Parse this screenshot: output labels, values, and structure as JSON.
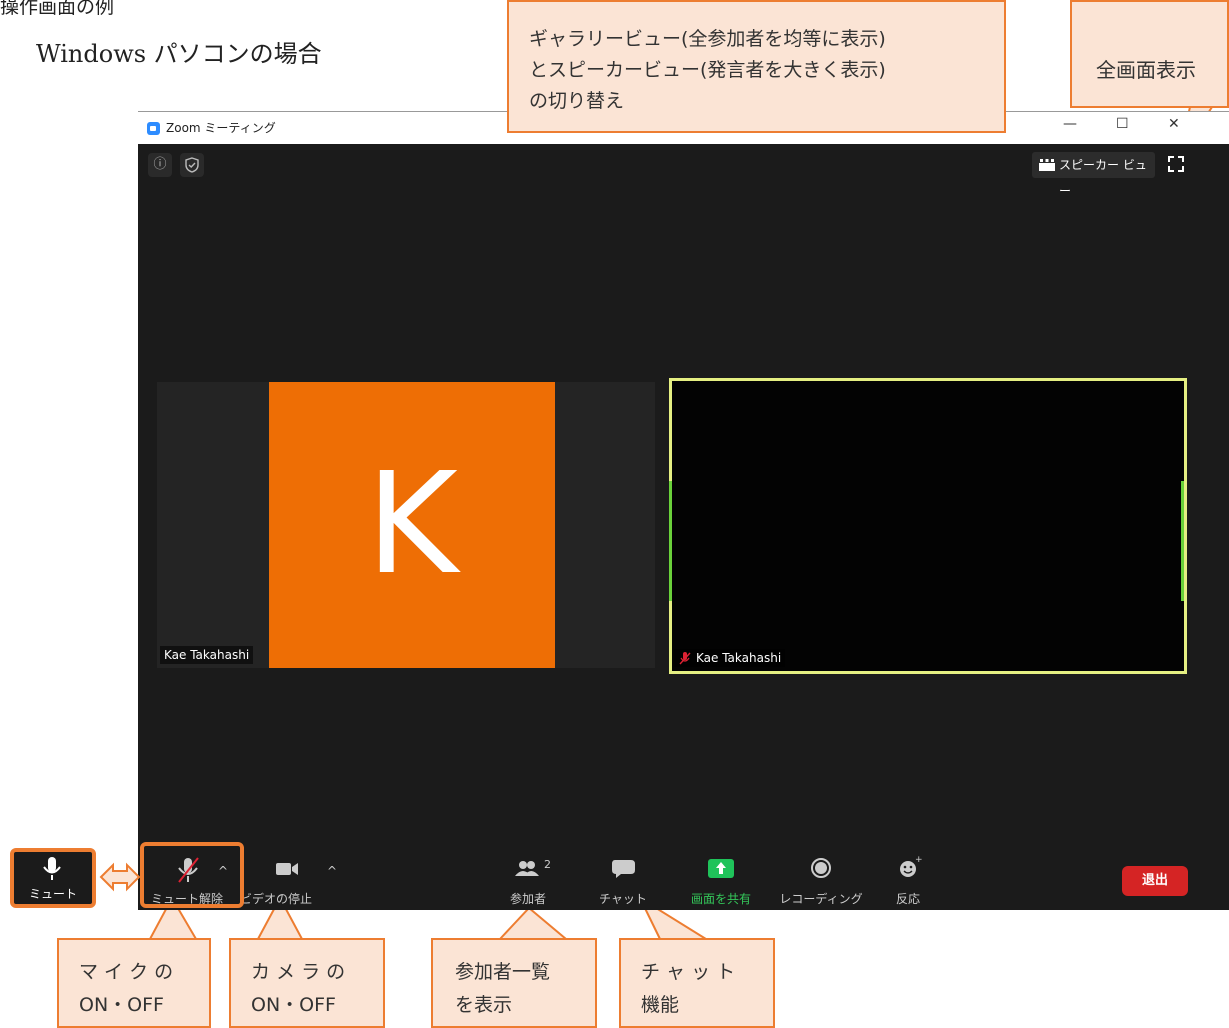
{
  "doc": {
    "heading": "操作画面の例",
    "subheading": "Windows パソコンの場合"
  },
  "window": {
    "title": "Zoom ミーティング",
    "minimize_glyph": "—",
    "maximize_glyph": "☐",
    "close_glyph": "✕",
    "info_glyph": "ⓘ",
    "security_glyph": "✓",
    "speaker_view_label": "スピーカー ビュー"
  },
  "participants": [
    {
      "name": "Kae Takahashi",
      "avatar_letter": "K"
    },
    {
      "name": "Kae Takahashi"
    }
  ],
  "toolbar": {
    "unmute_label": "ミュート解除",
    "video_label": "ビデオの停止",
    "participants_label": "参加者",
    "participants_count": "2",
    "chat_label": "チャット",
    "share_label": "画面を共有",
    "record_label": "レコーディング",
    "reactions_label": "反応",
    "leave_label": "退出",
    "caret_glyph": "^"
  },
  "mute_button": {
    "label": "ミュート"
  },
  "callouts": {
    "gallery": [
      "ギャラリービュー(全参加者を均等に表示)",
      "とスピーカービュー(発言者を大きく表示)",
      "の切り替え"
    ],
    "fullscreen": [
      "全画面表示"
    ],
    "mic": [
      "マ イ ク の",
      "ON・OFF"
    ],
    "camera": [
      "カ メ ラ の",
      "ON・OFF"
    ],
    "participants": [
      "参加者一覧",
      "を表示"
    ],
    "chat": [
      "チ ャ ッ ト",
      "機能"
    ]
  },
  "colors": {
    "callout_fill": "#fbe4d5",
    "callout_border": "#ed7d31",
    "avatar_bg": "#ee6e05",
    "active_speaker_border": "#e5ef82",
    "share_green": "#1fc35a",
    "leave_red": "#d52424"
  }
}
